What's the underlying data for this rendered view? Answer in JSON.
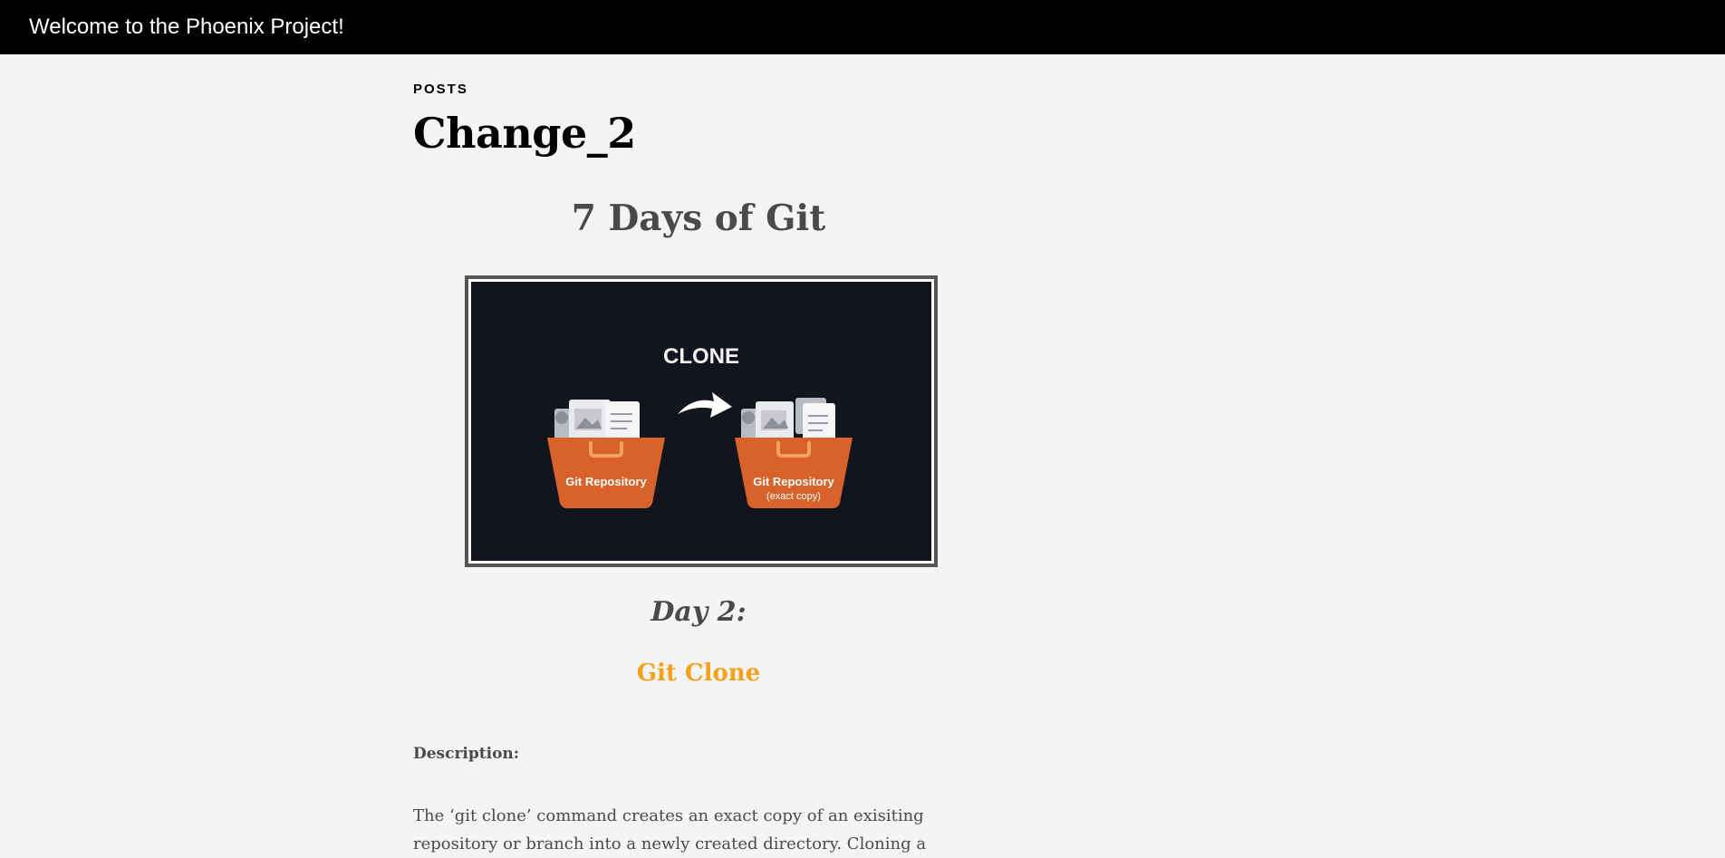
{
  "header": {
    "title": "Welcome to the Phoenix Project!"
  },
  "post": {
    "category": "POSTS",
    "title": "Change_2",
    "series_title": "7 Days of Git",
    "image": {
      "caption_top": "CLONE",
      "left_box_label": "Git Repository",
      "right_box_label": "Git Repository",
      "right_box_sublabel": "(exact copy)"
    },
    "day_label": "Day 2:",
    "topic": "Git Clone",
    "description_heading": "Description:",
    "description_lines": [
      "The ‘git clone’ command creates an exact copy of an exisiting",
      "repository or branch into a newly created directory. Cloning a"
    ]
  },
  "colors": {
    "header_bg": "#000000",
    "page_bg": "#f4f4f4",
    "accent_orange": "#f5a11c",
    "box_orange": "#d9622b",
    "image_bg": "#12151e"
  }
}
